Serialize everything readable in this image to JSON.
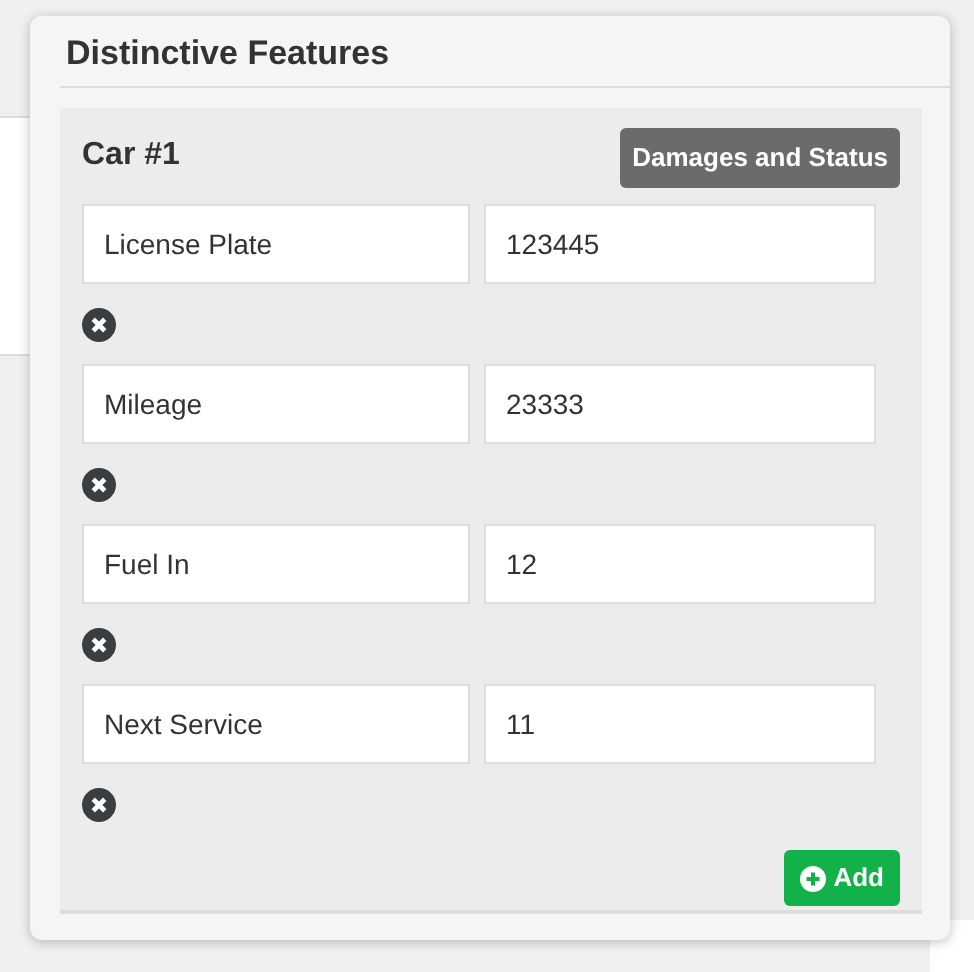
{
  "panel": {
    "title": "Distinctive Features"
  },
  "car": {
    "title": "Car #1",
    "status_button": "Damages and Status",
    "features": [
      {
        "name": "License Plate",
        "value": "123445"
      },
      {
        "name": "Mileage",
        "value": "23333"
      },
      {
        "name": "Fuel In",
        "value": "12"
      },
      {
        "name": "Next Service",
        "value": "11"
      }
    ],
    "add_button": "Add"
  }
}
